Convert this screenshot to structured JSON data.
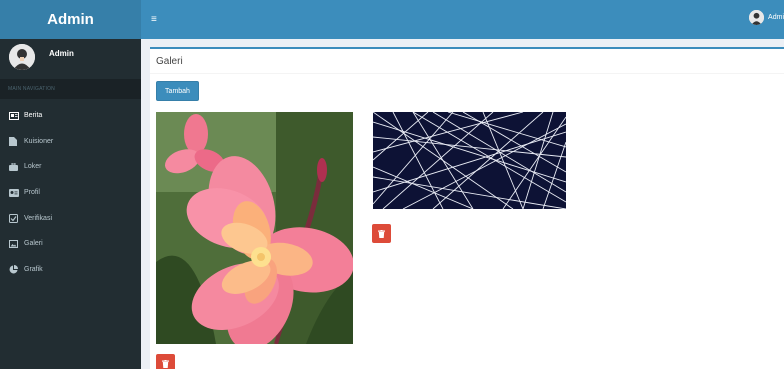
{
  "app": {
    "logo": "Admin"
  },
  "user": {
    "name": "Admin",
    "top_name": "Admi"
  },
  "sidebar": {
    "header": "MAIN NAVIGATION",
    "items": [
      {
        "label": "Berita",
        "icon": "newspaper-icon"
      },
      {
        "label": "Kuisioner",
        "icon": "file-icon"
      },
      {
        "label": "Loker",
        "icon": "briefcase-icon"
      },
      {
        "label": "Profil",
        "icon": "id-card-icon"
      },
      {
        "label": "Verifikasi",
        "icon": "check-square-icon"
      },
      {
        "label": "Galeri",
        "icon": "image-icon"
      },
      {
        "label": "Grafik",
        "icon": "pie-chart-icon"
      }
    ]
  },
  "topbar": {
    "toggle": "≡"
  },
  "main": {
    "title": "Galeri",
    "add_button": "Tambah"
  },
  "gallery": [
    {
      "image": "flower-image",
      "delete_icon": "trash-icon"
    },
    {
      "image": "abstract-lines-image",
      "delete_icon": "trash-icon"
    }
  ],
  "colors": {
    "sidebar_bg": "#222d32",
    "header_blue": "#3c8dbc",
    "logo_blue": "#367fa9",
    "danger": "#dd4b39",
    "content_bg": "#ecf0f5"
  }
}
